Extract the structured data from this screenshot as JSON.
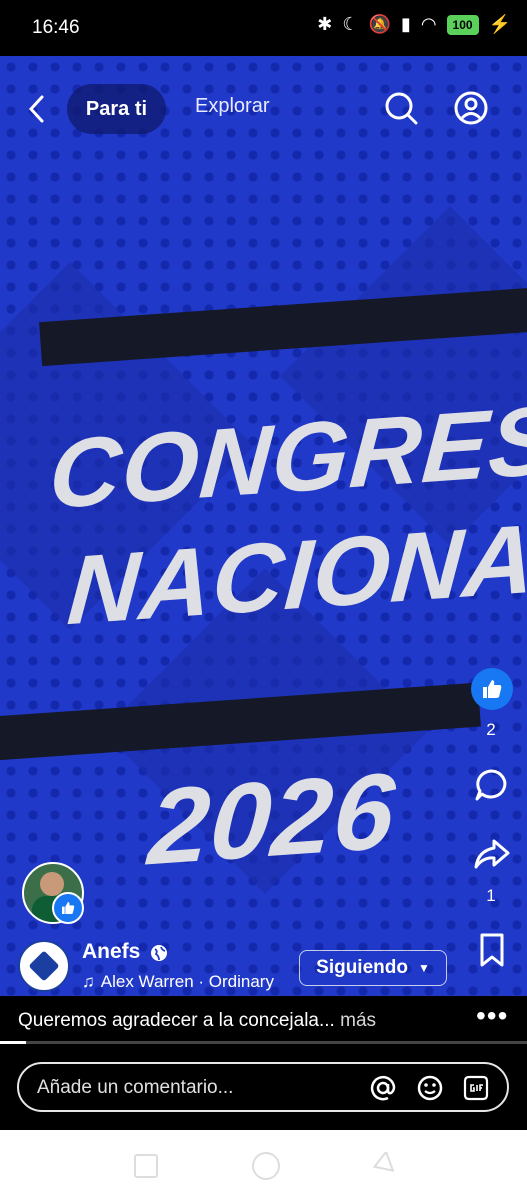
{
  "status_bar": {
    "time": "16:46",
    "battery": "100"
  },
  "nav": {
    "tab_for_you": "Para ti",
    "tab_explore": "Explorar"
  },
  "poster": {
    "line1": "CONGRESO",
    "line2": "NACIONAL",
    "year": "2026"
  },
  "actions": {
    "like_count": "2",
    "share_count": "1"
  },
  "author": {
    "name": "Anefs",
    "music": "Alex Warren · Ordinary",
    "follow_label": "Siguiendo"
  },
  "caption": {
    "text": "Queremos agradecer a la concejala...",
    "more": "más"
  },
  "comment": {
    "placeholder": "Añade un comentario..."
  },
  "colors": {
    "hero_blue": "#2039c8",
    "like_blue": "#1877f2"
  }
}
